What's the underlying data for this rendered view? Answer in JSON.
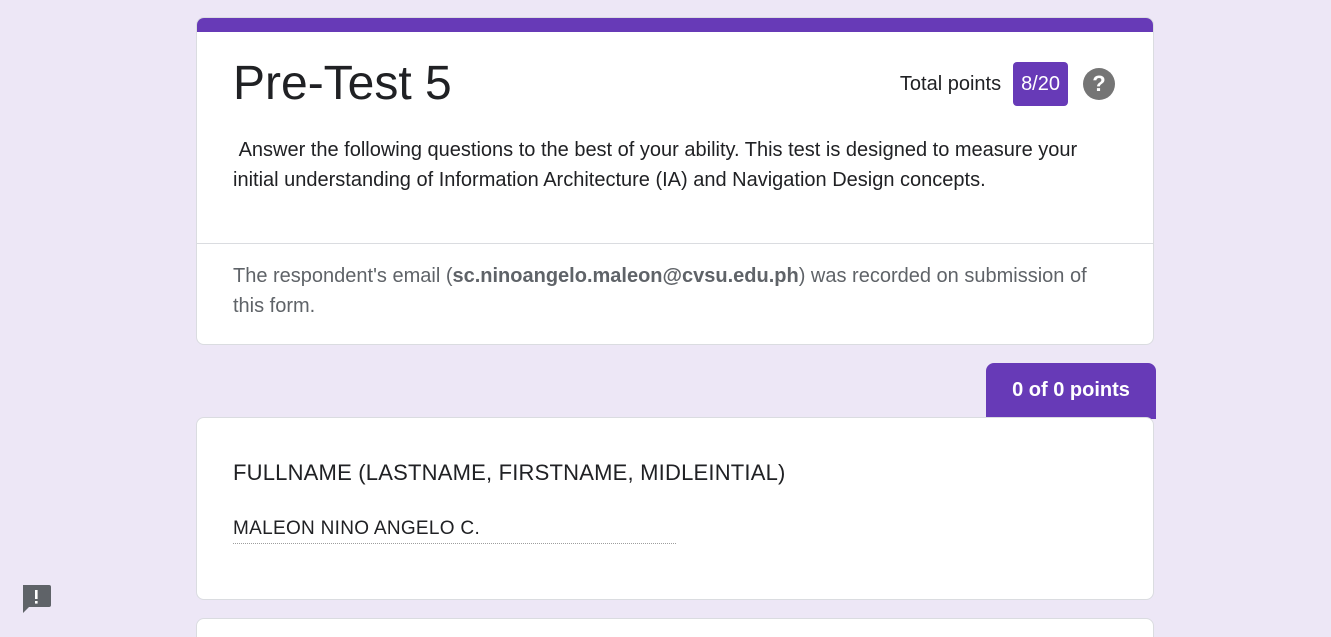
{
  "form": {
    "title": "Pre-Test 5",
    "total_points_label": "Total points",
    "score": "8/20",
    "help_icon": "help-circle-icon",
    "description": " Answer the following questions to the best of your ability. This test is designed to measure your initial understanding of Information Architecture (IA) and Navigation Design concepts.",
    "email_note": {
      "prefix": "The respondent's email (",
      "email": "sc.ninoangelo.maleon@cvsu.edu.ph",
      "suffix": ") was recorded on submission of this form."
    }
  },
  "section": {
    "points_label": "0 of 0 points"
  },
  "question": {
    "title": "FULLNAME (LASTNAME, FIRSTNAME, MIDLEINTIAL)",
    "answer": "MALEON NINO ANGELO C."
  },
  "feedback": {
    "icon": "report-feedback-icon"
  },
  "colors": {
    "accent": "#673ab7",
    "background": "#ede7f6",
    "help_icon": "#757575",
    "feedback_icon": "#5f6368"
  }
}
